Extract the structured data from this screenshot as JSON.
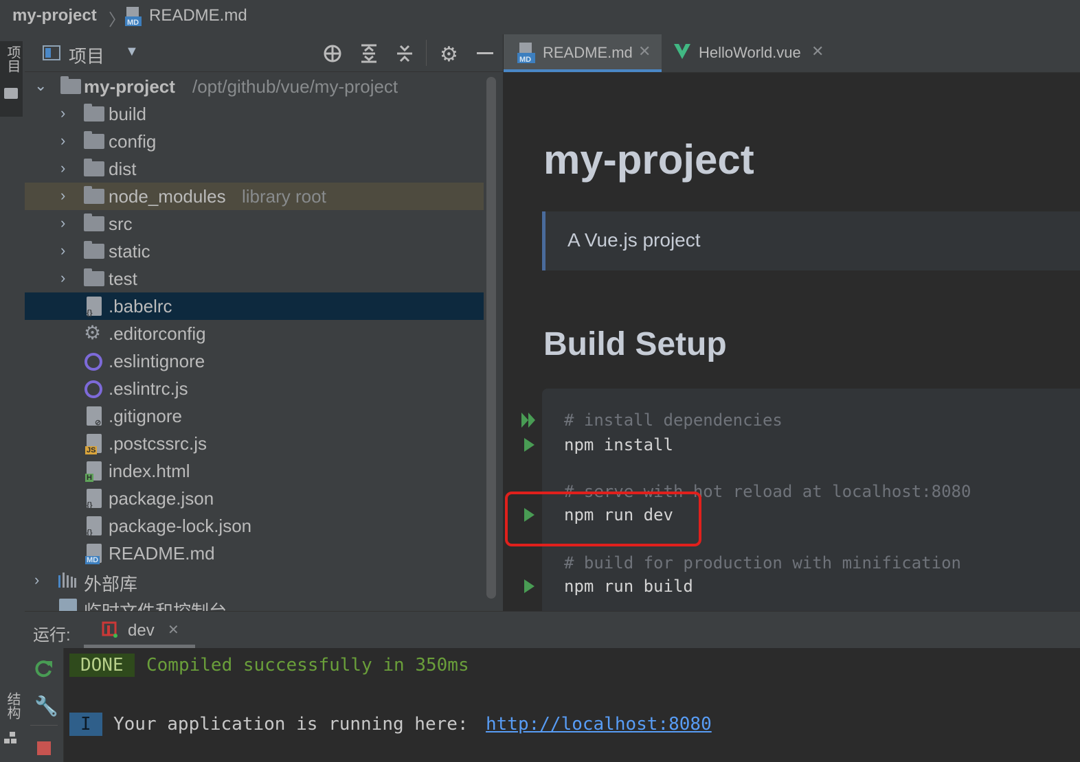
{
  "breadcrumb": {
    "project": "my-project",
    "separator": "〉",
    "file": "README.md"
  },
  "left_strip": {
    "project_label": "项目",
    "structure_label": "结构"
  },
  "project_panel": {
    "title": "项目",
    "root": {
      "name": "my-project",
      "path": "/opt/github/vue/my-project"
    },
    "items": [
      {
        "name": "build",
        "type": "folder"
      },
      {
        "name": "config",
        "type": "folder"
      },
      {
        "name": "dist",
        "type": "folder"
      },
      {
        "name": "node_modules",
        "type": "folder",
        "hint": "library root"
      },
      {
        "name": "src",
        "type": "folder"
      },
      {
        "name": "static",
        "type": "folder"
      },
      {
        "name": "test",
        "type": "folder"
      },
      {
        "name": ".babelrc",
        "type": "file",
        "icon": "json-file-icon",
        "selected": true
      },
      {
        "name": ".editorconfig",
        "type": "file",
        "icon": "gear-icon"
      },
      {
        "name": ".eslintignore",
        "type": "file",
        "icon": "eslint-icon"
      },
      {
        "name": ".eslintrc.js",
        "type": "file",
        "icon": "eslint-icon"
      },
      {
        "name": ".gitignore",
        "type": "file",
        "icon": "ignore-file-icon"
      },
      {
        "name": ".postcssrc.js",
        "type": "file",
        "icon": "js-file-icon",
        "badge": "JS"
      },
      {
        "name": "index.html",
        "type": "file",
        "icon": "html-file-icon",
        "badge": "H"
      },
      {
        "name": "package.json",
        "type": "file",
        "icon": "json-file-icon"
      },
      {
        "name": "package-lock.json",
        "type": "file",
        "icon": "json-file-icon"
      },
      {
        "name": "README.md",
        "type": "file",
        "icon": "markdown-file-icon",
        "badge": "MD"
      }
    ],
    "external_libraries": "外部库",
    "scratches": "临时文件和控制台"
  },
  "editor": {
    "tabs": [
      {
        "label": "README.md",
        "active": true,
        "badge": "MD"
      },
      {
        "label": "HelloWorld.vue",
        "active": false,
        "badge": "V"
      }
    ],
    "h1": "my-project",
    "blockquote": "A Vue.js project",
    "h2": "Build Setup",
    "code": {
      "c1": "# install dependencies",
      "l1": "npm install",
      "c2": "# serve with hot reload at localhost:8080",
      "l2": "npm run dev",
      "c3": "# build for production with minification",
      "l3": "npm run build"
    }
  },
  "run_panel": {
    "label": "运行:",
    "tab": "dev",
    "done_badge": "DONE",
    "done_text": "Compiled successfully in 350ms",
    "info_badge": "I",
    "info_text": "Your application is running here: ",
    "link": "http://localhost:8080"
  },
  "colors": {
    "accent_tab": "#4a88c7",
    "highlight_box": "#e0201c",
    "run_green": "#499c54",
    "success_text": "#6a9f3a"
  }
}
